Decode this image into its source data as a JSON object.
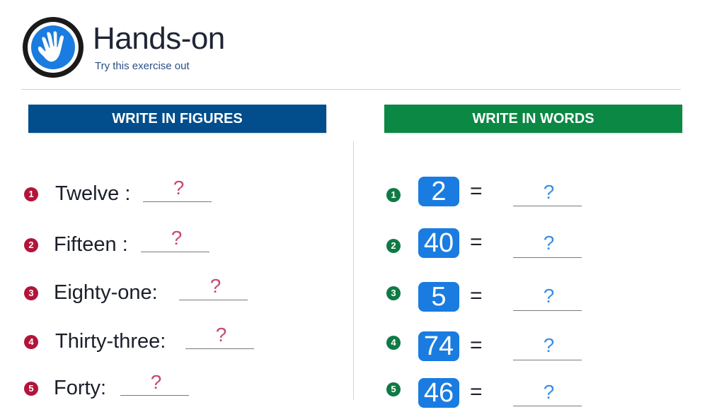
{
  "header": {
    "title": "Hands-on",
    "subtitle": "Try this exercise out"
  },
  "left": {
    "heading": "WRITE IN FIGURES",
    "items": [
      {
        "num": "1",
        "label": "Twelve :",
        "answer": "?"
      },
      {
        "num": "2",
        "label": "Fifteen :",
        "answer": "?"
      },
      {
        "num": "3",
        "label": "Eighty-one:",
        "answer": "?"
      },
      {
        "num": "4",
        "label": "Thirty-three:",
        "answer": "?"
      },
      {
        "num": "5",
        "label": "Forty:",
        "answer": "?"
      }
    ]
  },
  "right": {
    "heading": "WRITE IN WORDS",
    "equals": "=",
    "items": [
      {
        "num": "1",
        "value": "2",
        "answer": "?"
      },
      {
        "num": "2",
        "value": "40",
        "answer": "?"
      },
      {
        "num": "3",
        "value": "5",
        "answer": "?"
      },
      {
        "num": "4",
        "value": "74",
        "answer": "?"
      },
      {
        "num": "5",
        "value": "46",
        "answer": "?"
      }
    ]
  },
  "colors": {
    "left_header": "#024e8c",
    "right_header": "#0c8845",
    "number_box": "#1a7ce0",
    "left_bullet": "#b3143a",
    "right_bullet": "#0f7a44"
  },
  "icons": {
    "logo": "hand-icon"
  }
}
